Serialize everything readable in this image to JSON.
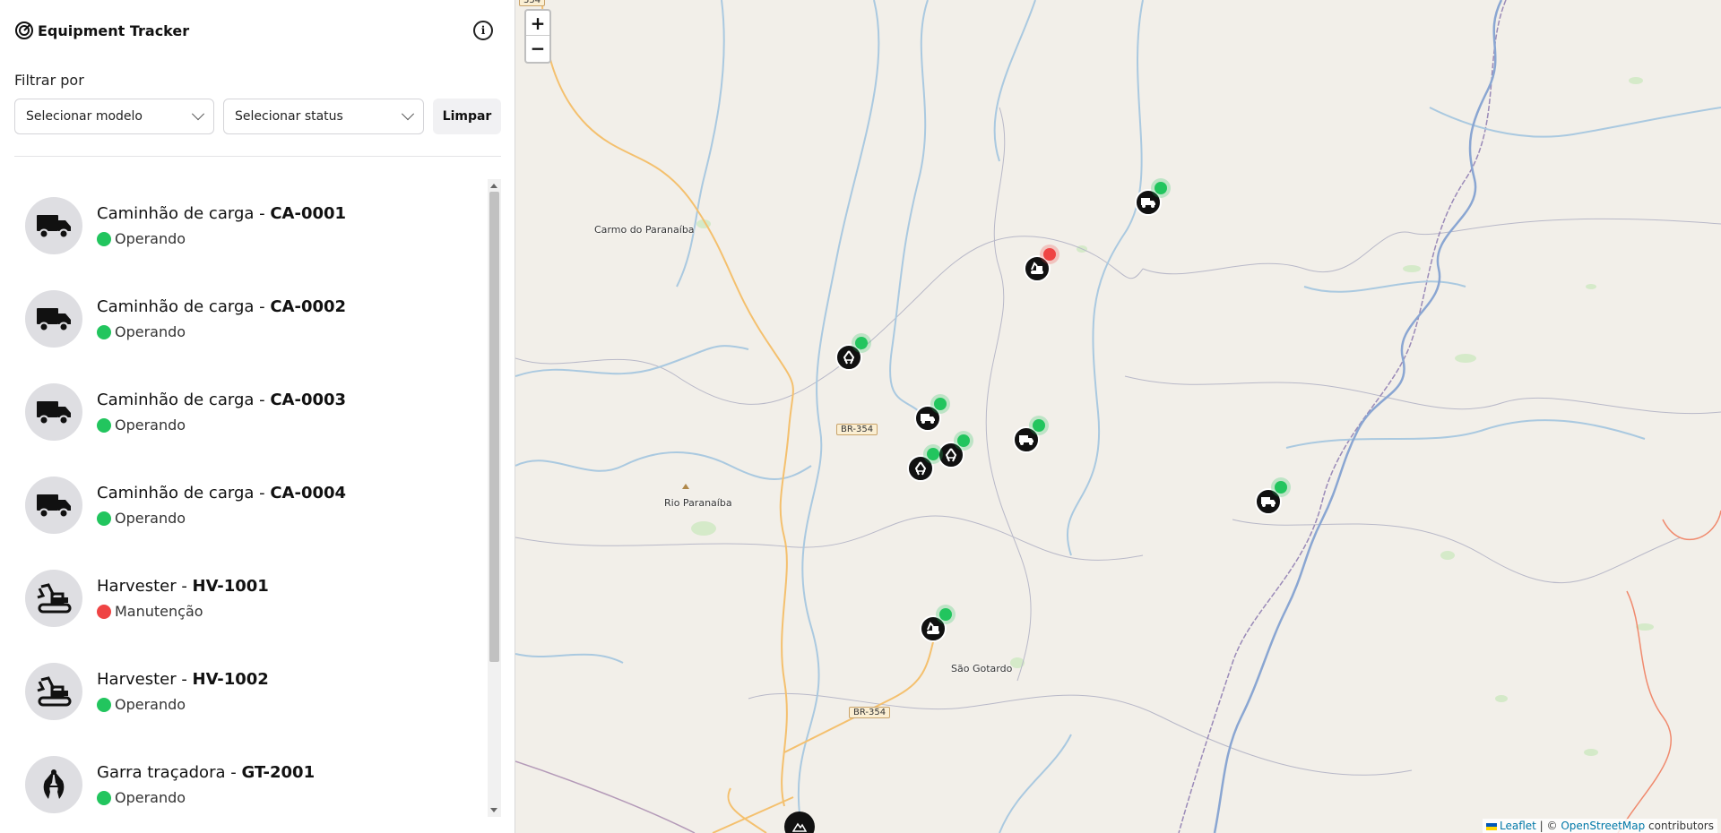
{
  "app": {
    "title": "Equipment Tracker"
  },
  "filters": {
    "label": "Filtrar por",
    "model_placeholder": "Selecionar modelo",
    "status_placeholder": "Selecionar status",
    "clear_label": "Limpar"
  },
  "equipment": [
    {
      "type": "Caminhão de carga - ",
      "code": "CA-0001",
      "status": "Operando",
      "status_color": "#22c55e",
      "icon": "truck-icon"
    },
    {
      "type": "Caminhão de carga - ",
      "code": "CA-0002",
      "status": "Operando",
      "status_color": "#22c55e",
      "icon": "truck-icon"
    },
    {
      "type": "Caminhão de carga - ",
      "code": "CA-0003",
      "status": "Operando",
      "status_color": "#22c55e",
      "icon": "truck-icon"
    },
    {
      "type": "Caminhão de carga - ",
      "code": "CA-0004",
      "status": "Operando",
      "status_color": "#22c55e",
      "icon": "truck-icon"
    },
    {
      "type": "Harvester - ",
      "code": "HV-1001",
      "status": "Manutenção",
      "status_color": "#ef4444",
      "icon": "harvester-icon"
    },
    {
      "type": "Harvester - ",
      "code": "HV-1002",
      "status": "Operando",
      "status_color": "#22c55e",
      "icon": "harvester-icon"
    },
    {
      "type": "Garra traçadora - ",
      "code": "GT-2001",
      "status": "Operando",
      "status_color": "#22c55e",
      "icon": "claw-icon"
    }
  ],
  "map": {
    "places": {
      "carmo": "Carmo do Paranaíba",
      "rio": "Rio Paranaíba",
      "sao_gotardo": "São Gotardo"
    },
    "roads": {
      "br354_a": "BR-354",
      "br354_b": "BR-354",
      "br354_top": "354"
    },
    "attribution": {
      "leaflet": "Leaflet",
      "separator": " | © ",
      "osm": "OpenStreetMap",
      "suffix": " contributors"
    },
    "zoom_in": "+",
    "zoom_out": "−"
  },
  "colors": {
    "operating": "#22c55e",
    "maintenance": "#ef4444"
  }
}
